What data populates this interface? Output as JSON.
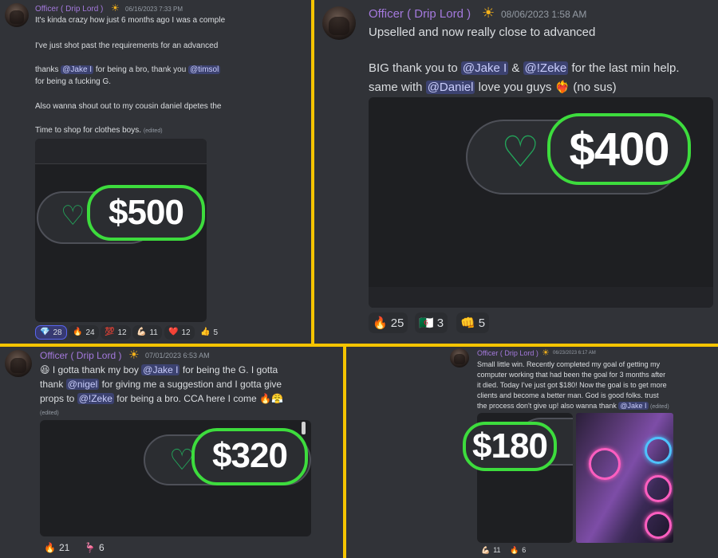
{
  "p1": {
    "username": "Officer ( Drip Lord )",
    "timestamp": "06/16/2023 7:33 PM",
    "lines": [
      "It's kinda crazy how just 6 months ago I was a comple",
      "I've just shot past the requirements for an advanced",
      "Also wanna shout out to my cousin daniel dpetes the",
      "Time to shop for clothes boys."
    ],
    "thanks": {
      "pre": "thanks",
      "m1": "@Jake I",
      "mid": "for being a bro, thank you",
      "m2": "@timsol",
      "line2": "for being a fucking G."
    },
    "edited": "(edited)",
    "amount": "$500",
    "reactions": [
      {
        "emoji": "💎",
        "count": "28"
      },
      {
        "emoji": "🔥",
        "count": "24"
      },
      {
        "emoji": "💯",
        "count": "12"
      },
      {
        "emoji": "💪🏻",
        "count": "11"
      },
      {
        "emoji": "❤️",
        "count": "12"
      },
      {
        "emoji": "👍",
        "count": "5"
      }
    ]
  },
  "p2": {
    "username": "Officer ( Drip Lord )",
    "timestamp": "08/06/2023 1:58 AM",
    "line1": "Upselled and now really close to advanced",
    "thanks": {
      "pre": "BIG thank you to",
      "m1": "@Jake I",
      "amp": "&",
      "m2": "@!Zeke",
      "post": "for the last min help."
    },
    "line3": {
      "pre": "same with",
      "m1": "@Daniel",
      "post": "love you guys",
      "emo": "❤️‍🔥",
      "tail": "(no sus)"
    },
    "amount": "$400",
    "reactions": [
      {
        "emoji": "🔥",
        "count": "25"
      },
      {
        "emoji": "🇩🇿",
        "count": "3"
      },
      {
        "emoji": "👊",
        "count": "5"
      }
    ]
  },
  "p3": {
    "username": "Officer ( Drip Lord )",
    "timestamp": "07/01/2023 6:53 AM",
    "l1": {
      "emo": "😆",
      "pre": "I gotta thank my boy",
      "m1": "@Jake I",
      "post": "for being the G. I gotta"
    },
    "l2": {
      "pre": "thank",
      "m1": "@nigel",
      "post": "for giving me a suggestion and I gotta give"
    },
    "l3": {
      "pre": "props to",
      "m1": "@!Zeke",
      "post": "for being a bro. CCA here I come",
      "emo": "🔥😤"
    },
    "edited": "(edited)",
    "amount": "$320",
    "reactions": [
      {
        "emoji": "🔥",
        "count": "21"
      },
      {
        "emoji": "🦩",
        "count": "6"
      }
    ]
  },
  "p4": {
    "username": "Officer ( Drip Lord )",
    "timestamp": "06/23/2023 6:17 AM",
    "lines": [
      "Small little win. Recently completed my goal of getting my",
      "computer working that had been the goal for 3 months after",
      "it died. Today I've just got $180! Now the goal is to get more",
      "clients and become a better man. God is good folks. trust"
    ],
    "last": {
      "pre": "the process don't give up! also wanna thank",
      "m1": "@Jake I"
    },
    "edited": "(edited)",
    "amount": "$180",
    "reactions": [
      {
        "emoji": "💪🏻",
        "count": "11"
      },
      {
        "emoji": "🔥",
        "count": "6"
      }
    ]
  }
}
